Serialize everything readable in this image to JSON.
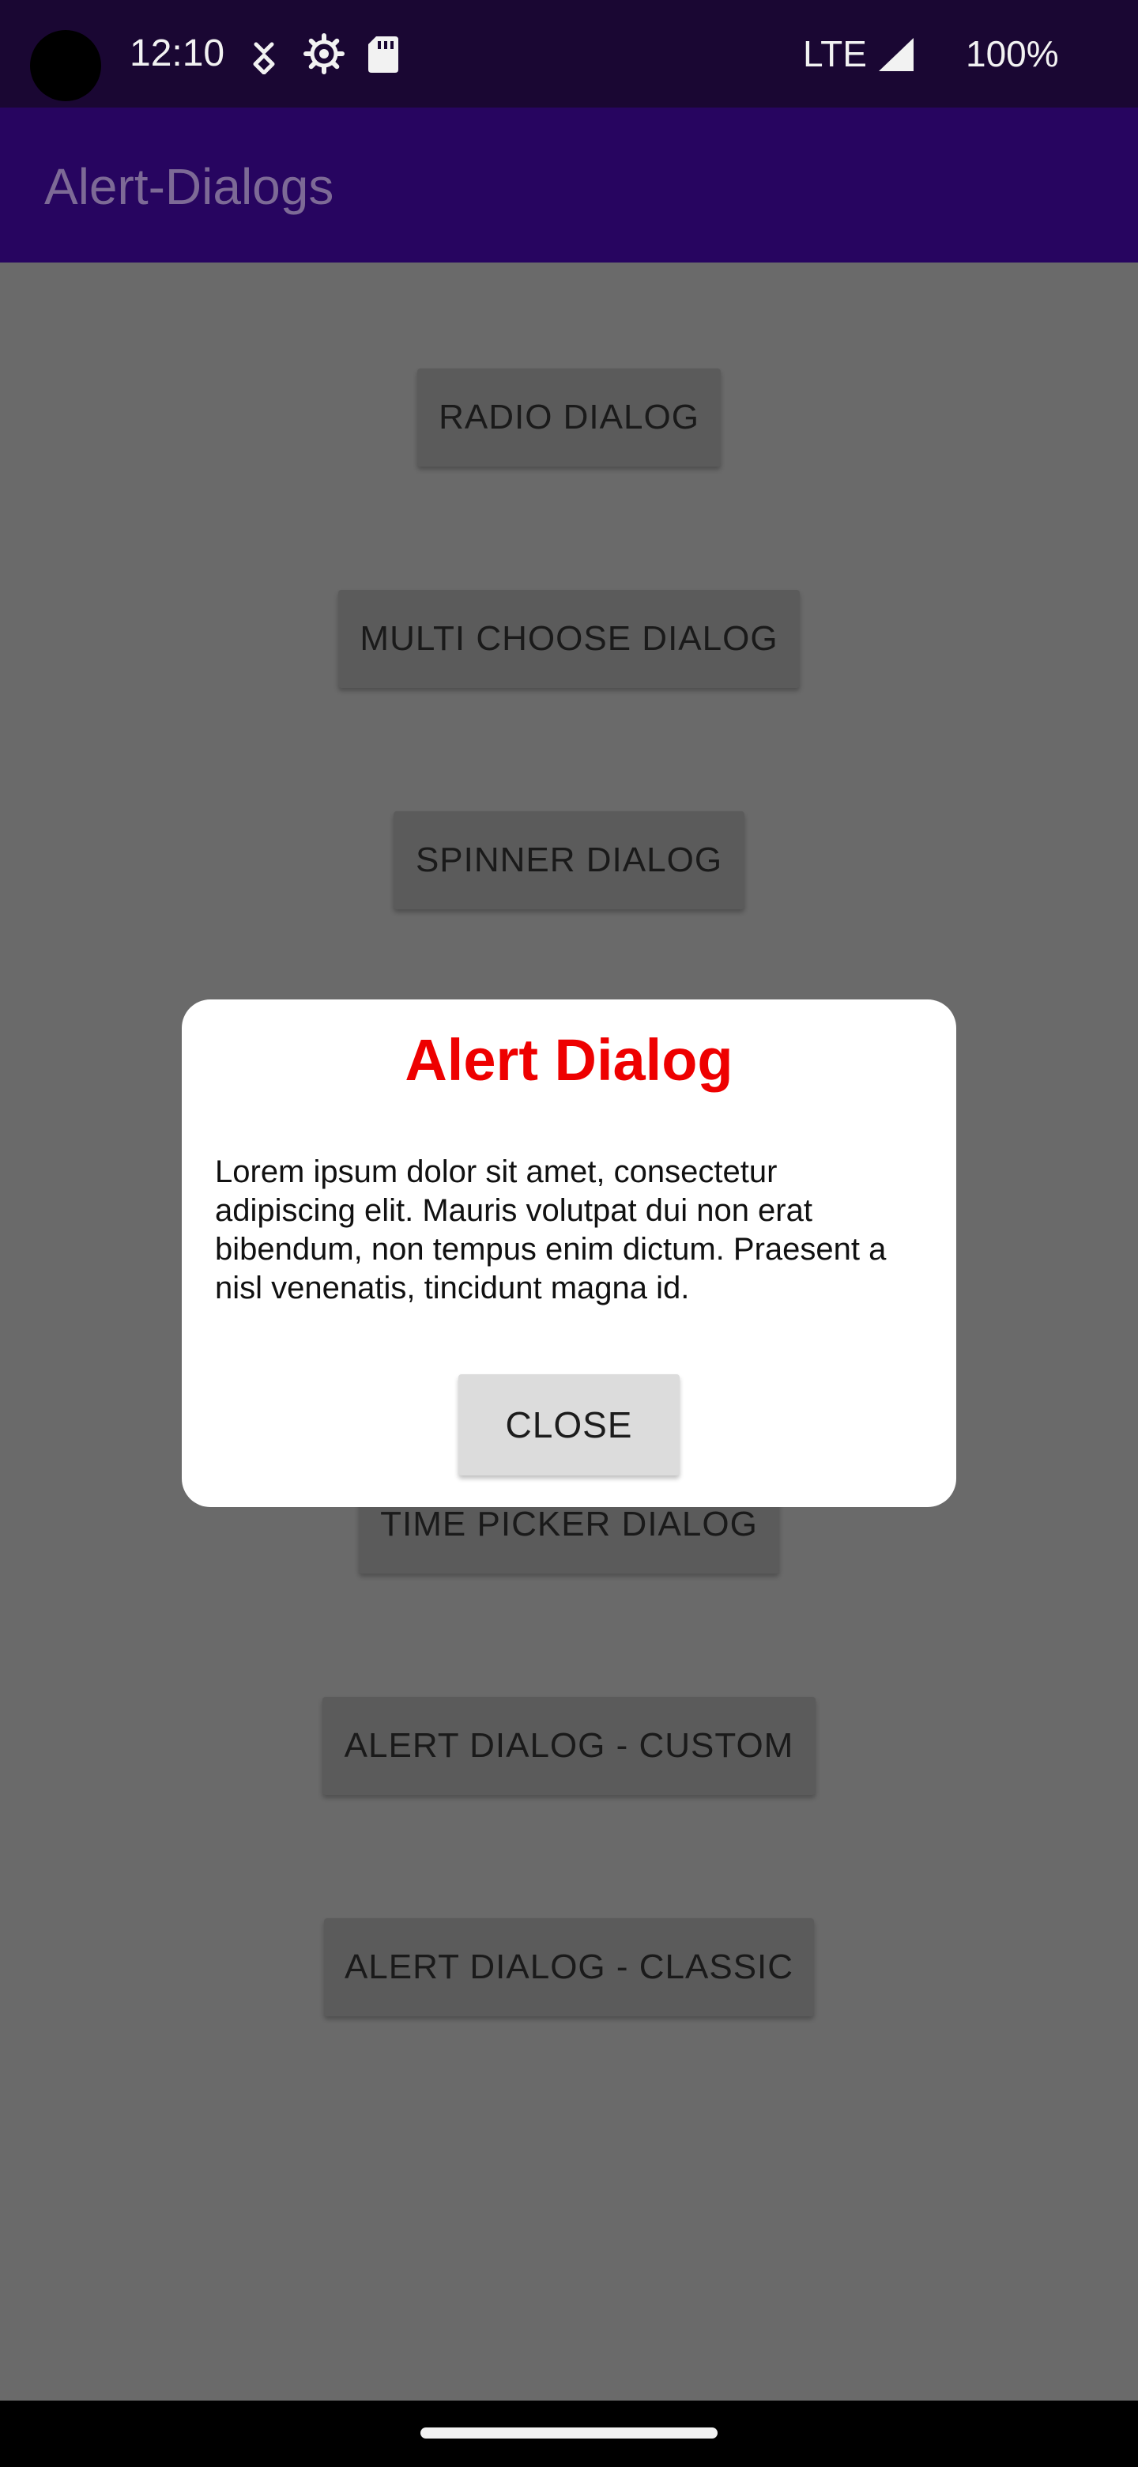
{
  "status_bar": {
    "time": "12:10",
    "network": "LTE",
    "battery": "100%",
    "icons": [
      "camera-cutout",
      "data-saver-icon",
      "settings-gear-icon",
      "sd-card-icon",
      "signal-icon"
    ]
  },
  "app_bar": {
    "title": "Alert-Dialogs"
  },
  "main": {
    "buttons": [
      {
        "label": "RADIO DIALOG"
      },
      {
        "label": "MULTI CHOOSE DIALOG"
      },
      {
        "label": "SPINNER DIALOG"
      },
      {
        "label": "TIME PICKER DIALOG"
      },
      {
        "label": "ALERT DIALOG - CUSTOM"
      },
      {
        "label": "ALERT DIALOG - CLASSIC"
      }
    ]
  },
  "dialog": {
    "title": "Alert Dialog",
    "message": "Lorem ipsum dolor sit amet, consectetur adipiscing elit. Mauris volutpat dui non erat bibendum, non tempus enim dictum. Praesent a nisl venenatis, tincidunt magna id.",
    "close_label": "CLOSE",
    "title_color": "#ee0000"
  },
  "colors": {
    "status_bar": "#1a0733",
    "app_bar": "#270560",
    "scrim_background": "#6a6a6a",
    "dialog_background": "#ffffff"
  }
}
